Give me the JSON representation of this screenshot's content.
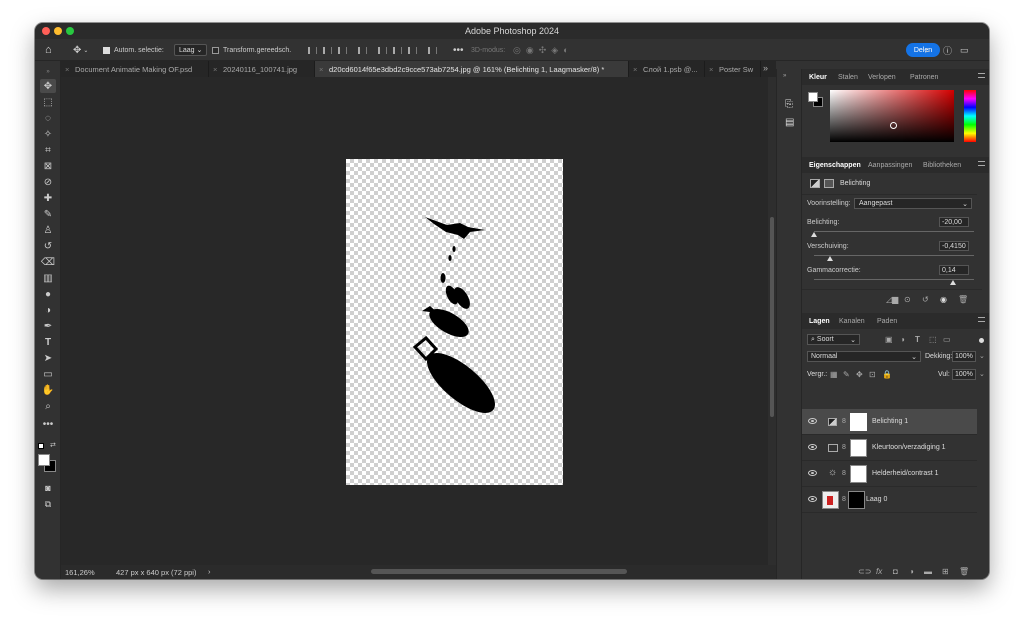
{
  "app": {
    "title": "Adobe Photoshop 2024"
  },
  "options_bar": {
    "auto_select_label": "Autom. selectie:",
    "auto_select_value": "Laag",
    "transform_label": "Transform.gereedsch.",
    "mode3d_label": "3D-modus:",
    "share_label": "Delen"
  },
  "tabs": [
    {
      "label": "Document Animatie Making OF.psd"
    },
    {
      "label": "20240116_100741.jpg"
    },
    {
      "label": "d20cd6014f65e3dbd2c9cce573ab7254.jpg @ 161% (Belichting 1, Laagmasker/8) *"
    },
    {
      "label": "Слой 1.psb @..."
    },
    {
      "label": "Poster Sw"
    }
  ],
  "status": {
    "zoom": "161,26%",
    "doc_info": "427 px x 640 px (72 ppi)"
  },
  "color_panel": {
    "tabs": [
      "Kleur",
      "Stalen",
      "Verlopen",
      "Patronen"
    ],
    "fg_color": "#ffffff",
    "bg_color": "#000000",
    "hue_color": "#d40000"
  },
  "properties_panel": {
    "tabs": [
      "Eigenschappen",
      "Aanpassingen",
      "Bibliotheken"
    ],
    "header": "Belichting",
    "preset_label": "Voorinstelling:",
    "preset_value": "Aangepast",
    "exposure_label": "Belichting:",
    "exposure_value": "-20,00",
    "exposure_level": 0,
    "offset_label": "Verschuiving:",
    "offset_value": "-0,4150",
    "offset_level": 0.1,
    "gamma_label": "Gammacorrectie:",
    "gamma_value": "0,14",
    "gamma_level": 0.87
  },
  "layers_panel": {
    "tabs": [
      "Lagen",
      "Kanalen",
      "Paden"
    ],
    "filter_label": "Soort",
    "blend_mode": "Normaal",
    "opacity_label": "Dekking:",
    "opacity_value": "100%",
    "lock_label": "Vergr.:",
    "fill_label": "Vul:",
    "fill_value": "100%",
    "layers": [
      {
        "name": "Belichting 1",
        "selected": true
      },
      {
        "name": "Kleurtoon/verzadiging 1",
        "selected": false
      },
      {
        "name": "Helderheid/contrast 1",
        "selected": false
      },
      {
        "name": "Laag 0",
        "selected": false
      }
    ]
  },
  "icons": {
    "home": "home-icon",
    "move": "move-icon",
    "search": "search-icon",
    "help": "help-icon",
    "more": "ellipsis-icon"
  }
}
